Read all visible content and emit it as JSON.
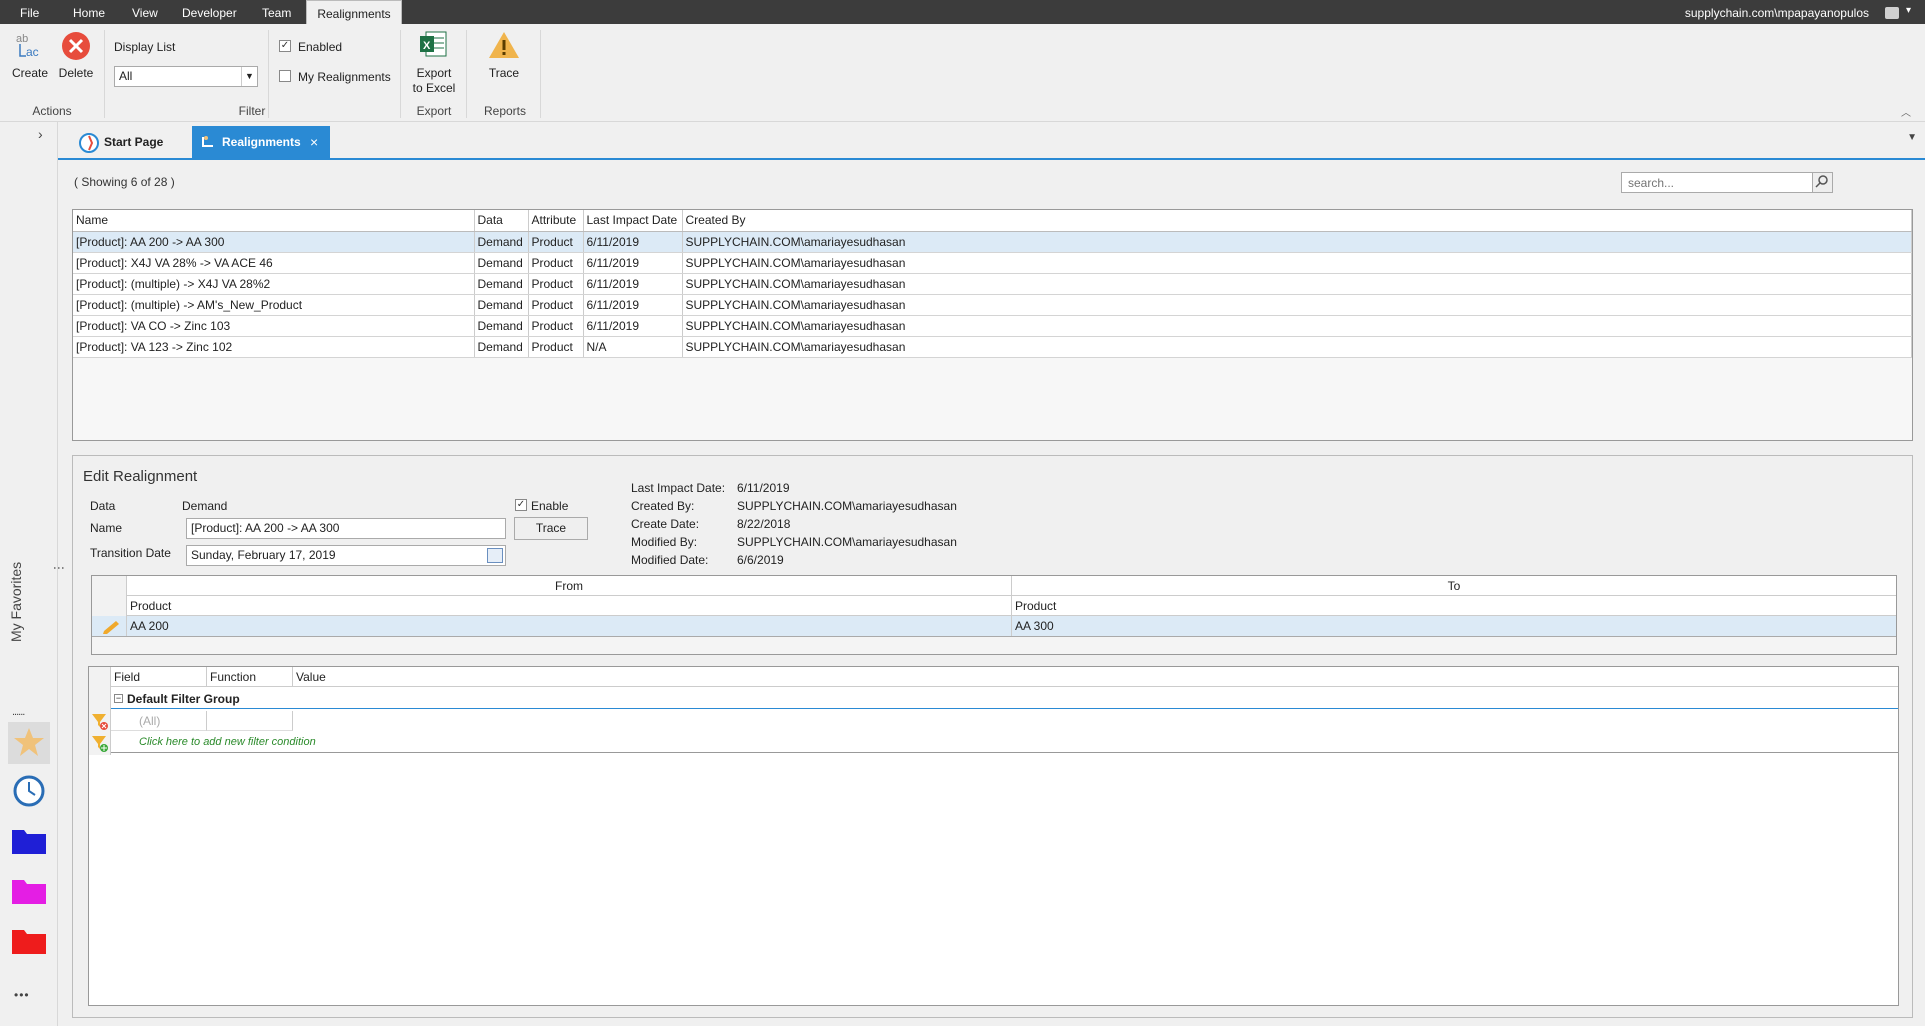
{
  "menubar": {
    "items": [
      "File",
      "Home",
      "View",
      "Developer",
      "Team",
      "Realignments"
    ],
    "active": "Realignments",
    "account": "supplychain.com\\mpapayanopulos"
  },
  "ribbon": {
    "actions": {
      "create_label": "Create",
      "delete_label": "Delete",
      "group_label": "Actions"
    },
    "filter": {
      "display_list_label": "Display List",
      "display_list_value": "All",
      "enabled_label": "Enabled",
      "enabled_checked": true,
      "my_realignments_label": "My Realignments",
      "my_realignments_checked": false,
      "group_label": "Filter"
    },
    "export": {
      "export_label_1": "Export",
      "export_label_2": "to Excel",
      "group_label": "Export"
    },
    "reports": {
      "trace_label": "Trace",
      "group_label": "Reports"
    }
  },
  "sidebar": {
    "favorites_label": "My Favorites",
    "more_dots": "......",
    "overflow": "•••"
  },
  "tabs": [
    {
      "label": "Start Page",
      "active": false
    },
    {
      "label": "Realignments",
      "active": true,
      "close": "×"
    }
  ],
  "list": {
    "status": "( Showing 6 of 28 )",
    "search_placeholder": "search...",
    "columns": [
      "Name",
      "Data",
      "Attribute",
      "Last Impact Date",
      "Created By"
    ],
    "rows": [
      [
        "[Product]: AA 200 -> AA 300",
        "Demand",
        "Product",
        "6/11/2019",
        "SUPPLYCHAIN.COM\\amariayesudhasan"
      ],
      [
        "[Product]: X4J VA 28% -> VA ACE 46",
        "Demand",
        "Product",
        "6/11/2019",
        "SUPPLYCHAIN.COM\\amariayesudhasan"
      ],
      [
        "[Product]: (multiple) -> X4J VA 28%2",
        "Demand",
        "Product",
        "6/11/2019",
        "SUPPLYCHAIN.COM\\amariayesudhasan"
      ],
      [
        "[Product]: (multiple) -> AM's_New_Product",
        "Demand",
        "Product",
        "6/11/2019",
        "SUPPLYCHAIN.COM\\amariayesudhasan"
      ],
      [
        "[Product]: VA CO -> Zinc 103",
        "Demand",
        "Product",
        "6/11/2019",
        "SUPPLYCHAIN.COM\\amariayesudhasan"
      ],
      [
        "[Product]: VA 123 -> Zinc 102",
        "Demand",
        "Product",
        "N/A",
        "SUPPLYCHAIN.COM\\amariayesudhasan"
      ]
    ],
    "selected_row": 0
  },
  "edit": {
    "title": "Edit Realignment",
    "data_label": "Data",
    "data_value": "Demand",
    "name_label": "Name",
    "name_value": "[Product]: AA 200 -> AA 300",
    "transition_label": "Transition Date",
    "transition_value": "Sunday, February 17, 2019",
    "enable_label": "Enable",
    "enable_checked": true,
    "trace_button": "Trace",
    "info": [
      {
        "label": "Last Impact Date:",
        "value": "6/11/2019"
      },
      {
        "label": "Created By:",
        "value": "SUPPLYCHAIN.COM\\amariayesudhasan"
      },
      {
        "label": "Create Date:",
        "value": "8/22/2018"
      },
      {
        "label": "Modified By:",
        "value": "SUPPLYCHAIN.COM\\amariayesudhasan"
      },
      {
        "label": "Modified Date:",
        "value": "6/6/2019"
      }
    ],
    "mapping": {
      "from_header": "From",
      "to_header": "To",
      "from_sub": "Product",
      "to_sub": "Product",
      "from_value": "AA 200",
      "to_value": "AA 300"
    },
    "filter": {
      "columns": [
        "Field",
        "Function",
        "Value"
      ],
      "group_label": "Default Filter Group",
      "all_label": "(All)",
      "add_label": "Click here to add new filter condition"
    }
  },
  "colors": {
    "accent": "#2a8ad4",
    "tab_active": "#2a8ad4",
    "delete_red": "#e74c3c",
    "menubar": "#3c3c3c"
  }
}
